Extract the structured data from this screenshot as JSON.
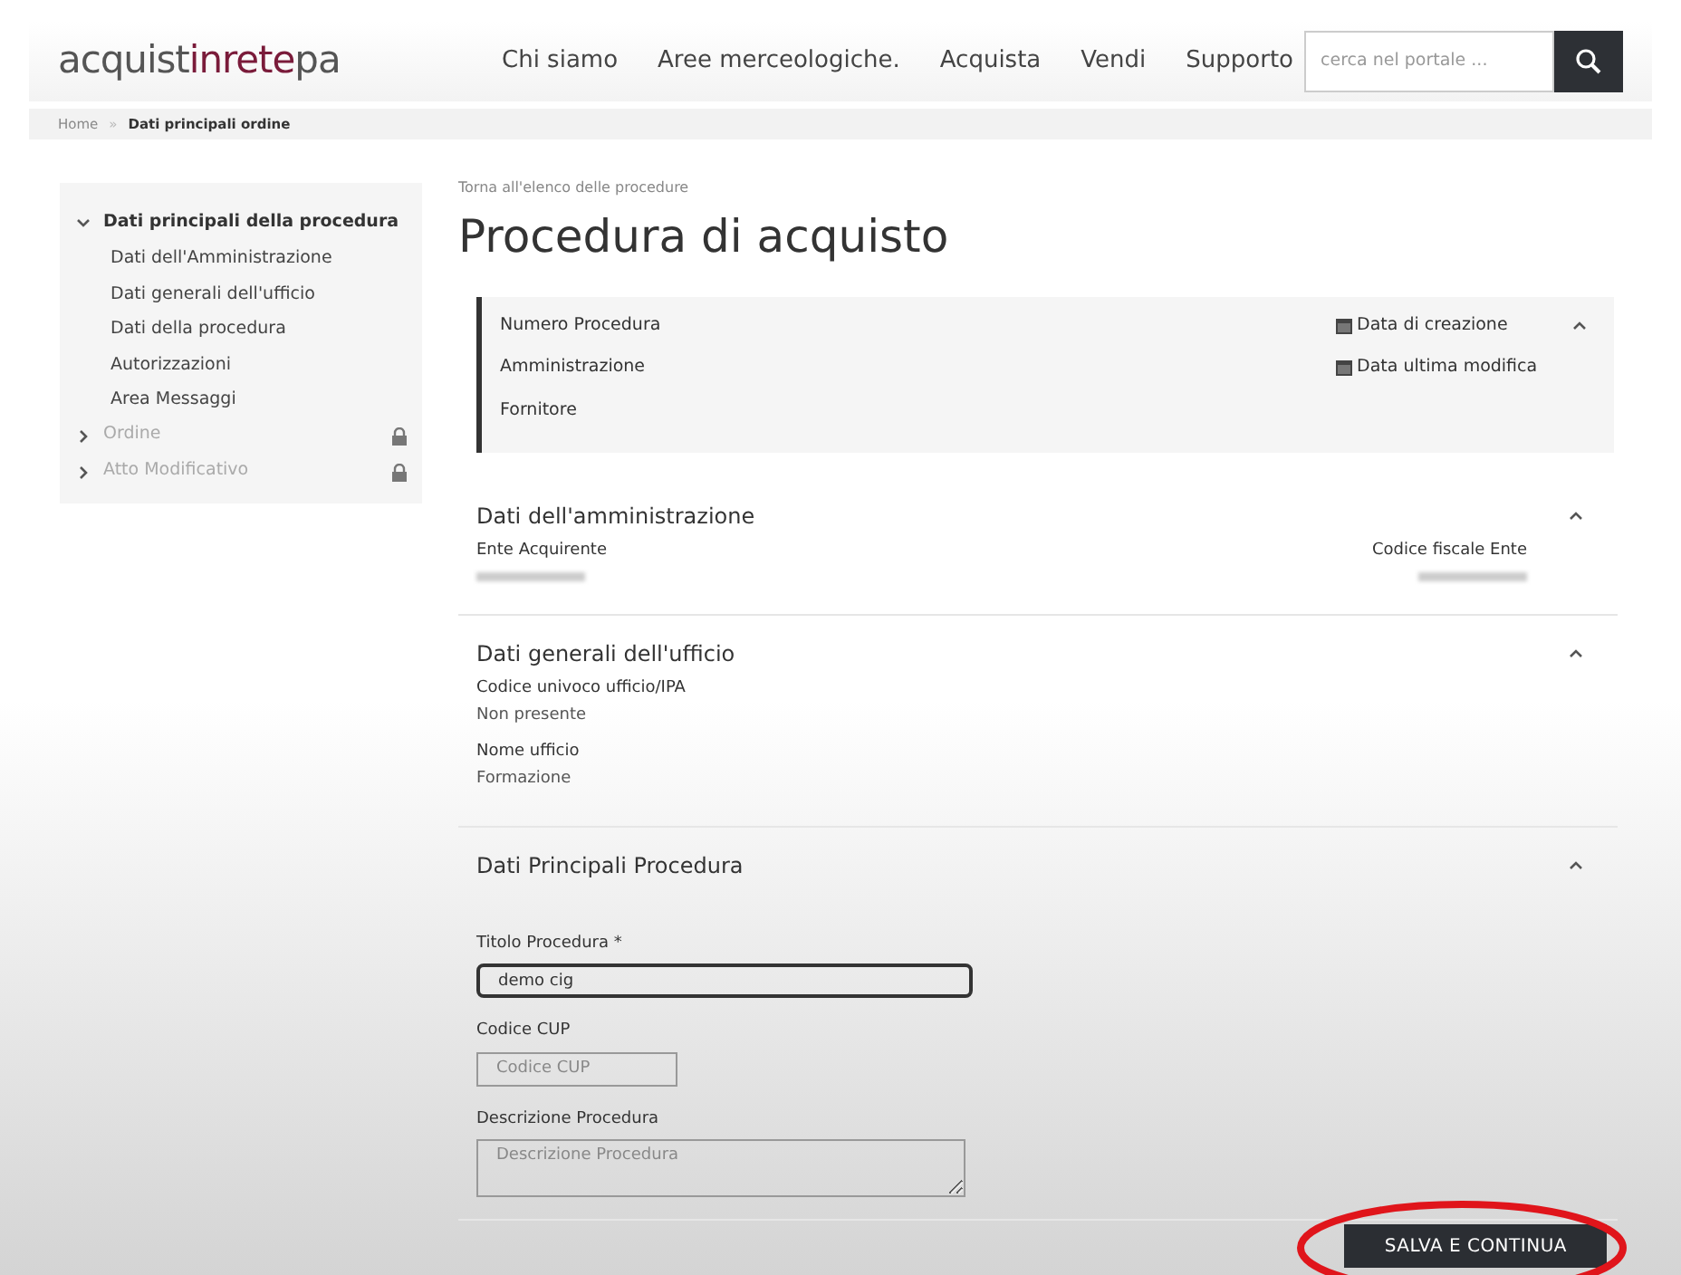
{
  "header": {
    "logo": {
      "part_1": "acquist",
      "part_2": "inrete",
      "part_3": "pa"
    },
    "nav": [
      "Chi siamo",
      "Aree merceologiche.",
      "Acquista",
      "Vendi",
      "Supporto"
    ],
    "search": {
      "placeholder": "cerca nel portale ..."
    }
  },
  "breadcrumb_separator": "»",
  "breadcrumb": [
    {
      "label": "Home",
      "current": false
    },
    {
      "label": "Dati principali ordine",
      "current": true
    }
  ],
  "sidebar": {
    "items": [
      {
        "label": "Dati principali della procedura",
        "expanded": true,
        "locked": false,
        "disabled": false,
        "children": [
          {
            "label": "Dati dell'Amministrazione"
          },
          {
            "label": "Dati generali dell'ufficio"
          },
          {
            "label": "Dati della procedura"
          },
          {
            "label": "Autorizzazioni"
          },
          {
            "label": "Area Messaggi"
          }
        ]
      },
      {
        "label": "Ordine",
        "expanded": false,
        "locked": true,
        "disabled": true
      },
      {
        "label": "Atto Modificativo",
        "expanded": false,
        "locked": true,
        "disabled": true
      }
    ]
  },
  "back_link": "Torna all'elenco delle procedure",
  "title": "Procedura di acquisto",
  "summary": {
    "left": [
      "Numero Procedura",
      "Amministrazione",
      "Fornitore"
    ],
    "right": [
      "Data di creazione",
      "Data ultima modifica"
    ]
  },
  "sections": [
    {
      "kind": "fields",
      "title": "Dati dell'amministrazione",
      "expanded": true,
      "fields": [
        {
          "label": "Ente Acquirente",
          "kind": "redacted"
        }
      ],
      "right_fields": [
        {
          "label": "Codice fiscale Ente",
          "kind": "redacted"
        }
      ]
    },
    {
      "kind": "fields",
      "title": "Dati generali dell'ufficio",
      "expanded": true,
      "fields": [
        {
          "label": "Codice univoco ufficio/IPA",
          "value": "Non presente",
          "kind": "text"
        },
        {
          "label": "Nome ufficio",
          "value": "Formazione",
          "kind": "text"
        }
      ]
    },
    {
      "kind": "form",
      "title": "Dati Principali Procedura",
      "expanded": true,
      "inputs": [
        {
          "kind": "text",
          "label": "Titolo Procedura",
          "required_mark": "*",
          "value": "demo cig",
          "focused": true
        },
        {
          "kind": "short",
          "label": "Codice CUP",
          "placeholder": "Codice CUP",
          "focused": false
        },
        {
          "kind": "textarea",
          "label": "Descrizione Procedura",
          "placeholder": "Descrizione Procedura",
          "focused": false
        }
      ]
    }
  ],
  "submit_button": {
    "label": "SALVA E CONTINUA",
    "highlighted": true
  }
}
